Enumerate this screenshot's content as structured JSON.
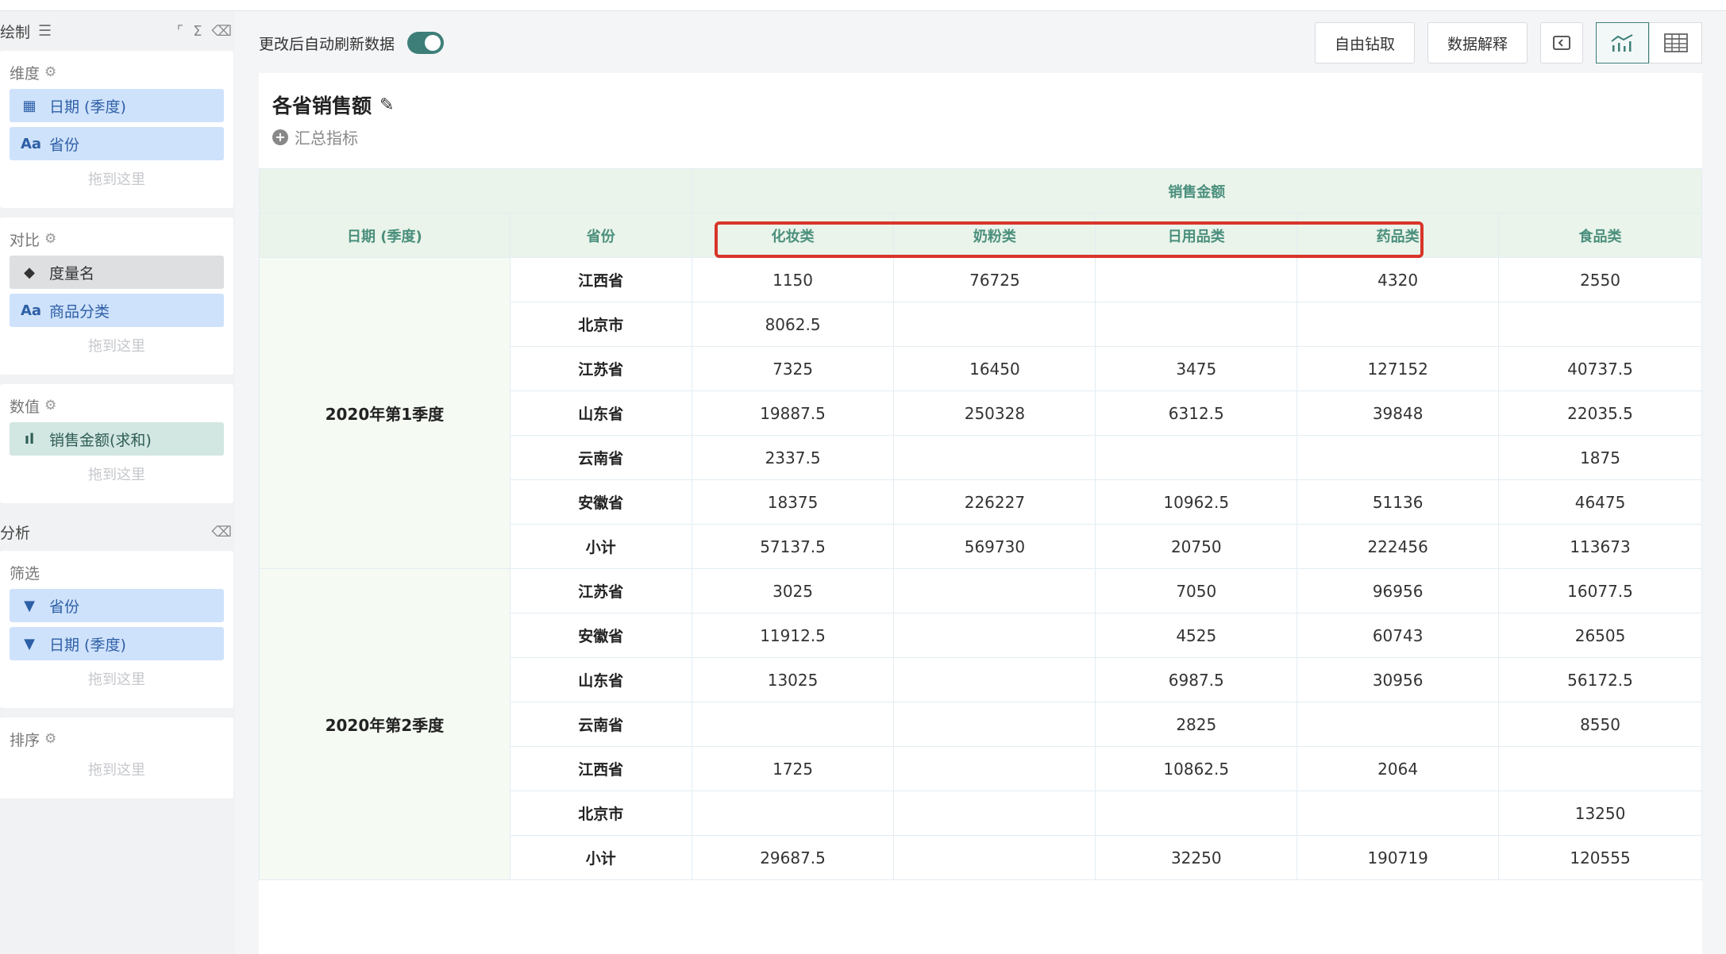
{
  "sidebar": {
    "header": {
      "title": "绘制",
      "icons": [
        "sliders-icon",
        "corner-icon",
        "sigma-icon",
        "eraser-icon"
      ]
    },
    "dimension": {
      "label": "维度",
      "items": [
        {
          "icon": "calendar-icon",
          "label": "日期 (季度)"
        },
        {
          "icon": "text-icon",
          "label": "省份"
        }
      ],
      "drop_hint": "拖到这里"
    },
    "compare": {
      "label": "对比",
      "items": [
        {
          "icon": "tag-icon",
          "label": "度量名"
        },
        {
          "icon": "text-icon",
          "label": "商品分类"
        }
      ],
      "drop_hint": "拖到这里"
    },
    "values": {
      "label": "数值",
      "items": [
        {
          "icon": "bar-chart-icon",
          "label": "销售金额(求和)"
        }
      ],
      "drop_hint": "拖到这里"
    },
    "analysis": {
      "title": "分析"
    },
    "filter": {
      "label": "筛选",
      "items": [
        {
          "icon": "filter-icon",
          "label": "省份"
        },
        {
          "icon": "filter-icon",
          "label": "日期 (季度)"
        }
      ],
      "drop_hint": "拖到这里"
    },
    "sort": {
      "label": "排序",
      "drop_hint": "拖到这里"
    }
  },
  "toolbar": {
    "auto_refresh_label": "更改后自动刷新数据",
    "auto_refresh_on": true,
    "drill_button": "自由钻取",
    "explain_button": "数据解释"
  },
  "card": {
    "title": "各省销售额",
    "summary_label": "汇总指标"
  },
  "table": {
    "measure_header": "销售金额",
    "row_headers": [
      "日期 (季度)",
      "省份"
    ],
    "columns": [
      "化妆类",
      "奶粉类",
      "日用品类",
      "药品类",
      "食品类"
    ],
    "groups": [
      {
        "quarter": "2020年第1季度",
        "rows": [
          {
            "province": "江西省",
            "values": [
              "1150",
              "76725",
              "",
              "4320",
              "2550"
            ]
          },
          {
            "province": "北京市",
            "values": [
              "8062.5",
              "",
              "",
              "",
              ""
            ]
          },
          {
            "province": "江苏省",
            "values": [
              "7325",
              "16450",
              "3475",
              "127152",
              "40737.5"
            ]
          },
          {
            "province": "山东省",
            "values": [
              "19887.5",
              "250328",
              "6312.5",
              "39848",
              "22035.5"
            ]
          },
          {
            "province": "云南省",
            "values": [
              "2337.5",
              "",
              "",
              "",
              "1875"
            ]
          },
          {
            "province": "安徽省",
            "values": [
              "18375",
              "226227",
              "10962.5",
              "51136",
              "46475"
            ]
          },
          {
            "province": "小计",
            "values": [
              "57137.5",
              "569730",
              "20750",
              "222456",
              "113673"
            ]
          }
        ]
      },
      {
        "quarter": "2020年第2季度",
        "rows": [
          {
            "province": "江苏省",
            "values": [
              "3025",
              "",
              "7050",
              "96956",
              "16077.5"
            ]
          },
          {
            "province": "安徽省",
            "values": [
              "11912.5",
              "",
              "4525",
              "60743",
              "26505"
            ]
          },
          {
            "province": "山东省",
            "values": [
              "13025",
              "",
              "6987.5",
              "30956",
              "56172.5"
            ]
          },
          {
            "province": "云南省",
            "values": [
              "",
              "",
              "2825",
              "",
              "8550"
            ]
          },
          {
            "province": "江西省",
            "values": [
              "1725",
              "",
              "10862.5",
              "2064",
              ""
            ]
          },
          {
            "province": "北京市",
            "values": [
              "",
              "",
              "",
              "",
              "13250"
            ]
          },
          {
            "province": "小计",
            "values": [
              "29687.5",
              "",
              "32250",
              "190719",
              "120555"
            ]
          }
        ]
      }
    ]
  },
  "colors": {
    "accent": "#3d7f78",
    "header_bg": "#eaf4ea",
    "highlight": "#d8352a",
    "pill_blue": "#cfe2fb"
  }
}
